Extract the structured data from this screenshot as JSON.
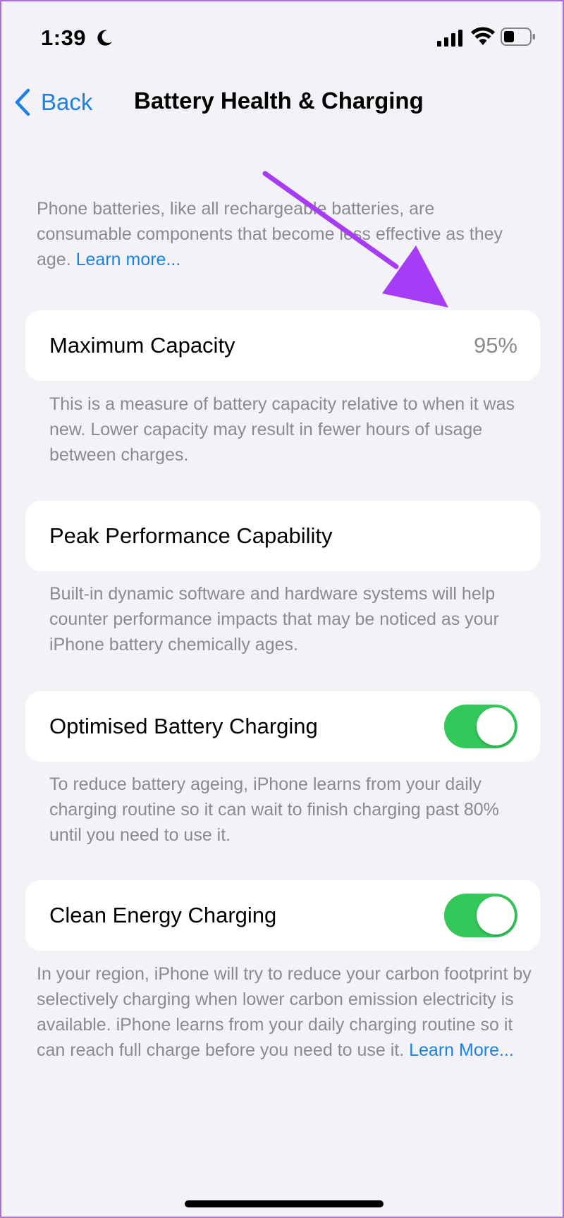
{
  "status_bar": {
    "time": "1:39",
    "icons": [
      "moon-icon",
      "signal-icon",
      "wifi-icon",
      "battery-icon"
    ]
  },
  "nav": {
    "back_label": "Back",
    "title": "Battery Health & Charging"
  },
  "intro": {
    "text": "Phone batteries, like all rechargeable batteries, are consumable components that become less effective as they age. ",
    "link": "Learn more..."
  },
  "maximum_capacity": {
    "label": "Maximum Capacity",
    "value": "95%",
    "description": "This is a measure of battery capacity relative to when it was new. Lower capacity may result in fewer hours of usage between charges."
  },
  "peak_performance": {
    "label": "Peak Performance Capability",
    "description": "Built-in dynamic software and hardware systems will help counter performance impacts that may be noticed as your iPhone battery chemically ages."
  },
  "optimised_charging": {
    "label": "Optimised Battery Charging",
    "enabled": true,
    "description": "To reduce battery ageing, iPhone learns from your daily charging routine so it can wait to finish charging past 80% until you need to use it."
  },
  "clean_energy": {
    "label": "Clean Energy Charging",
    "enabled": true,
    "description": "In your region, iPhone will try to reduce your carbon footprint by selectively charging when lower carbon emission electricity is available. iPhone learns from your daily charging routine so it can reach full charge before you need to use it. ",
    "link": "Learn More..."
  },
  "colors": {
    "accent": "#1a82e6",
    "toggle_on": "#34c759",
    "annotation_arrow": "#a63cf5",
    "background": "#f2f2f7"
  }
}
